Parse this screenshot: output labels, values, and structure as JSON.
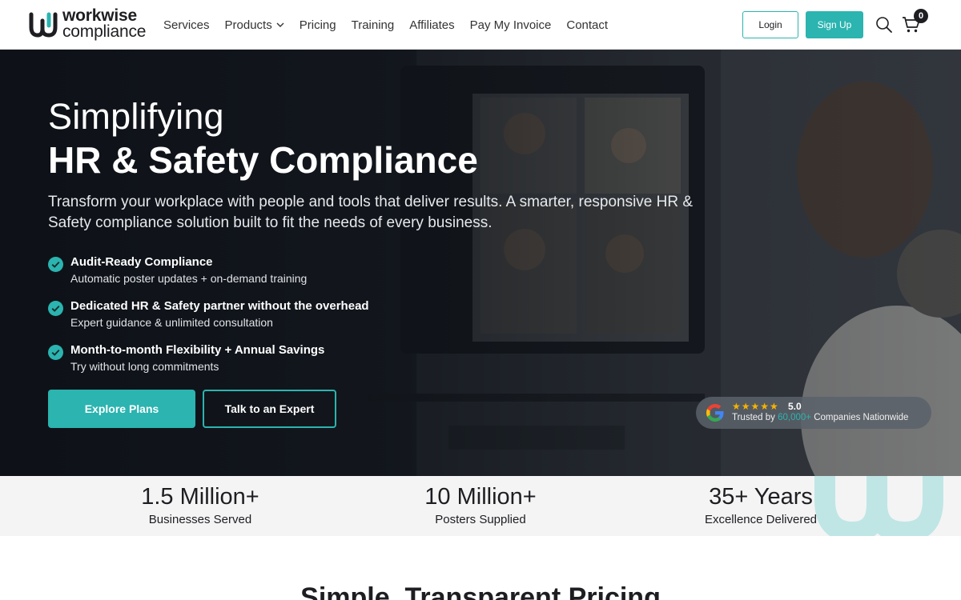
{
  "brand": {
    "name_line1": "workwise",
    "name_line2": "compliance",
    "accent": "#2bb4b0",
    "dark": "#1e1e22"
  },
  "nav": {
    "items": [
      {
        "label": "Services",
        "dropdown": false
      },
      {
        "label": "Products",
        "dropdown": true
      },
      {
        "label": "Pricing",
        "dropdown": false
      },
      {
        "label": "Training",
        "dropdown": false
      },
      {
        "label": "Affiliates",
        "dropdown": false
      },
      {
        "label": "Pay My Invoice",
        "dropdown": false
      },
      {
        "label": "Contact",
        "dropdown": false
      }
    ],
    "login_label": "Login",
    "signup_label": "Sign Up",
    "cart_count": "0",
    "icons": [
      "search-icon",
      "cart-icon",
      "chevron-down-icon"
    ]
  },
  "hero": {
    "title_line1": "Simplifying",
    "title_line2": "HR & Safety Compliance",
    "subtitle": "Transform your workplace with people and tools that deliver results. A smarter, responsive HR & Safety compliance solution built to fit the needs of every business.",
    "features": [
      {
        "title": "Audit-Ready Compliance",
        "desc": "Automatic poster updates + on-demand training"
      },
      {
        "title": "Dedicated HR & Safety partner without the overhead",
        "desc": "Expert guidance & unlimited consultation"
      },
      {
        "title": "Month-to-month Flexibility + Annual Savings",
        "desc": "Try without long commitments"
      }
    ],
    "primary_cta": "Explore Plans",
    "secondary_cta": "Talk to an Expert",
    "rating": {
      "stars": "★★★★★",
      "score": "5.0",
      "prefix": "Trusted by ",
      "highlight": "60,000+",
      "suffix": " Companies Nationwide"
    }
  },
  "stats": [
    {
      "value": "1.5 Million+",
      "label": "Businesses Served"
    },
    {
      "value": "10 Million+",
      "label": "Posters Supplied"
    },
    {
      "value": "35+ Years",
      "label": "Excellence Delivered"
    }
  ],
  "pricing": {
    "title": "Simple, Transparent Pricing"
  }
}
